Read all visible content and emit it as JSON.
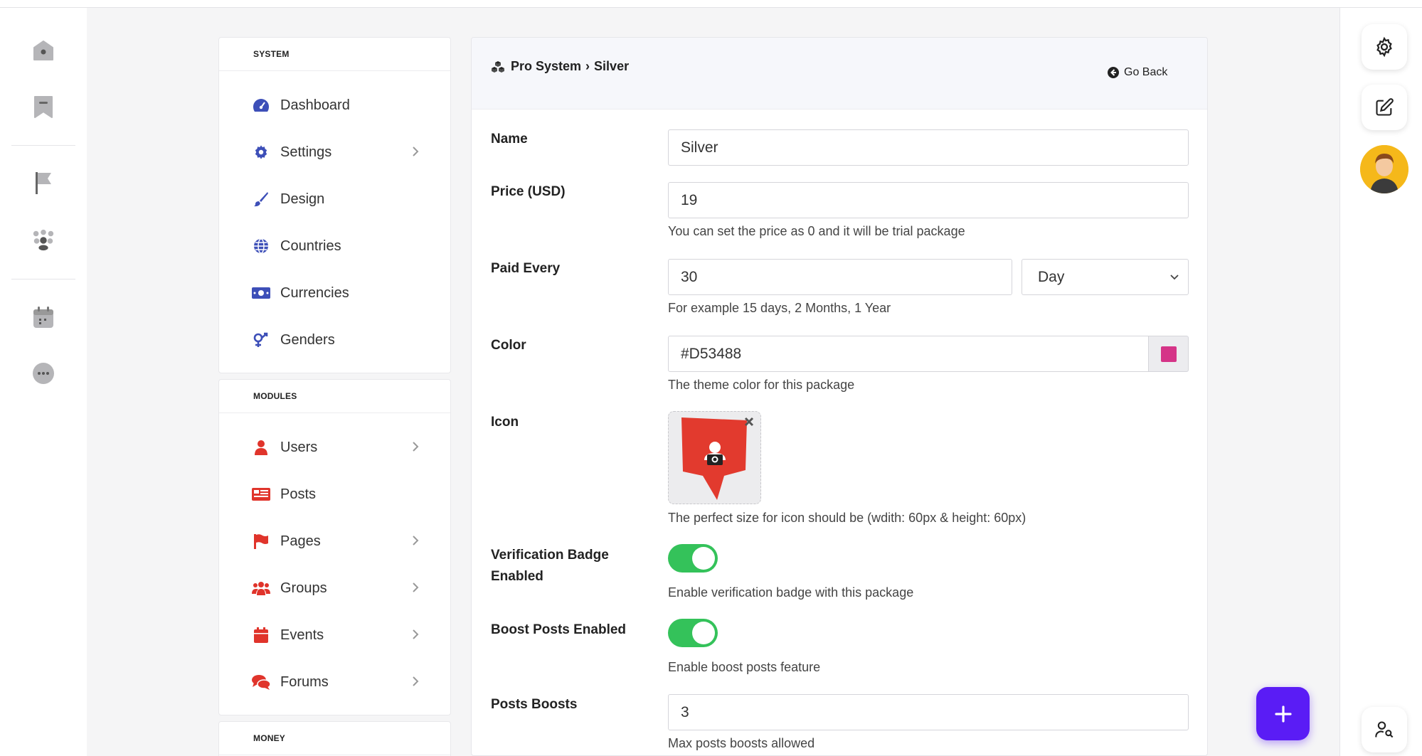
{
  "sidebar": {
    "system_header": "SYSTEM",
    "system_items": [
      {
        "label": "Dashboard",
        "icon": "gauge-icon",
        "chevron": false
      },
      {
        "label": "Settings",
        "icon": "gear-icon",
        "chevron": true
      },
      {
        "label": "Design",
        "icon": "brush-icon",
        "chevron": false
      },
      {
        "label": "Countries",
        "icon": "globe-icon",
        "chevron": false
      },
      {
        "label": "Currencies",
        "icon": "money-icon",
        "chevron": false
      },
      {
        "label": "Genders",
        "icon": "gender-icon",
        "chevron": false
      }
    ],
    "modules_header": "MODULES",
    "module_items": [
      {
        "label": "Users",
        "icon": "user-icon",
        "chevron": true
      },
      {
        "label": "Posts",
        "icon": "newspaper-icon",
        "chevron": false
      },
      {
        "label": "Pages",
        "icon": "flag-icon",
        "chevron": true
      },
      {
        "label": "Groups",
        "icon": "users-icon",
        "chevron": true
      },
      {
        "label": "Events",
        "icon": "calendar-icon",
        "chevron": true
      },
      {
        "label": "Forums",
        "icon": "comments-icon",
        "chevron": true
      }
    ],
    "money_header": "MONEY"
  },
  "header": {
    "breadcrumb_section": "Pro System",
    "breadcrumb_separator": "›",
    "breadcrumb_current": "Silver",
    "go_back": "Go Back"
  },
  "form": {
    "name": {
      "label": "Name",
      "value": "Silver"
    },
    "price": {
      "label": "Price (USD)",
      "value": "19",
      "help": "You can set the price as 0 and it will be trial package"
    },
    "paid_every": {
      "label": "Paid Every",
      "value": "30",
      "unit": "Day",
      "help": "For example 15 days, 2 Months, 1 Year"
    },
    "color": {
      "label": "Color",
      "value": "#D53488",
      "help": "The theme color for this package",
      "swatch": "#D53488"
    },
    "icon": {
      "label": "Icon",
      "help": "The perfect size for icon should be (wdith: 60px & height: 60px)"
    },
    "verification": {
      "label_line1": "Verification Badge",
      "label_line2": "Enabled",
      "enabled": true,
      "help": "Enable verification badge with this package"
    },
    "boost": {
      "label": "Boost Posts Enabled",
      "enabled": true,
      "help": "Enable boost posts feature"
    },
    "posts_boosts": {
      "label": "Posts Boosts",
      "value": "3",
      "help": "Max posts boosts allowed"
    }
  },
  "colors": {
    "accent": "#5a1cf5",
    "nav_system": "#3d4fb8",
    "nav_modules": "#e0342b",
    "toggle_on": "#34c25a"
  }
}
